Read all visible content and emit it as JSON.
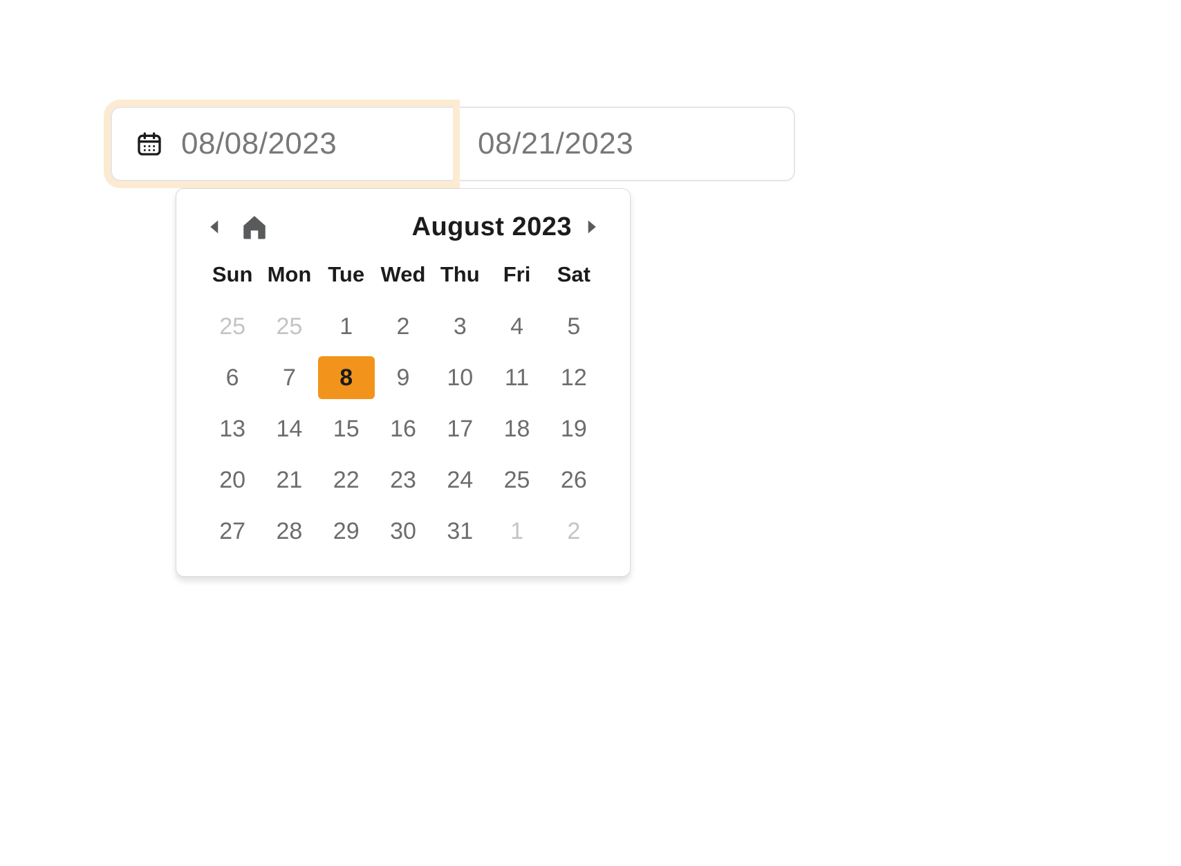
{
  "range": {
    "start": "08/08/2023",
    "end": "08/21/2023"
  },
  "calendar": {
    "title": "August 2023",
    "weekdays": [
      "Sun",
      "Mon",
      "Tue",
      "Wed",
      "Thu",
      "Fri",
      "Sat"
    ],
    "selected_day": "8",
    "weeks": [
      [
        {
          "d": "25",
          "out": true
        },
        {
          "d": "25",
          "out": true
        },
        {
          "d": "1"
        },
        {
          "d": "2"
        },
        {
          "d": "3"
        },
        {
          "d": "4"
        },
        {
          "d": "5"
        }
      ],
      [
        {
          "d": "6"
        },
        {
          "d": "7"
        },
        {
          "d": "8",
          "sel": true
        },
        {
          "d": "9"
        },
        {
          "d": "10"
        },
        {
          "d": "11"
        },
        {
          "d": "12"
        }
      ],
      [
        {
          "d": "13"
        },
        {
          "d": "14"
        },
        {
          "d": "15"
        },
        {
          "d": "16"
        },
        {
          "d": "17"
        },
        {
          "d": "18"
        },
        {
          "d": "19"
        }
      ],
      [
        {
          "d": "20"
        },
        {
          "d": "21"
        },
        {
          "d": "22"
        },
        {
          "d": "23"
        },
        {
          "d": "24"
        },
        {
          "d": "25"
        },
        {
          "d": "26"
        }
      ],
      [
        {
          "d": "27"
        },
        {
          "d": "28"
        },
        {
          "d": "29"
        },
        {
          "d": "30"
        },
        {
          "d": "31"
        },
        {
          "d": "1",
          "out": true
        },
        {
          "d": "2",
          "out": true
        }
      ]
    ]
  },
  "colors": {
    "accent": "#f2941b",
    "focus_ring": "#fcebd2"
  }
}
